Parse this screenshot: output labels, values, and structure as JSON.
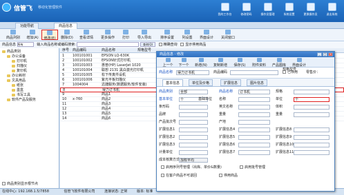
{
  "app": {
    "brand": "信管飞",
    "slogan": "移动化管理软件"
  },
  "top_buttons": [
    "我的工作台",
    "修改密码",
    "操作员管理",
    "系统设置",
    "更换操作员",
    "退出系统"
  ],
  "tabs": [
    "功能导航",
    "商品信息"
  ],
  "toolbar": [
    "商品列别",
    "增加(A)",
    "修改(E)",
    "删除(D)",
    "查看详情",
    "更多操作",
    "打印",
    "导入导出",
    "排序设置",
    "列设置",
    "界面设计",
    "关闭窗口"
  ],
  "search": {
    "type_label": "商品信息",
    "type_value": "所有",
    "hint": "输入商品名称或编码搜索:",
    "search_btn": "查询(Q)",
    "check1": "精确查询",
    "check2": "显示停用商品"
  },
  "tree": {
    "root": "商品类别",
    "nodes": [
      "办公设备",
      "打印机",
      "扫描仪",
      "复印机",
      "办公耗材",
      "文具用品",
      "纸张",
      "墨盒",
      "书写工具",
      "软件产品及服务"
    ],
    "bottom_check": "商品类别显示根节点"
  },
  "grid": {
    "headers": [
      "序号",
      "商品编码",
      "商品名称",
      "规格型号"
    ],
    "rows": [
      [
        "1",
        "100101001",
        "EPSON LQ-630K",
        ""
      ],
      [
        "2",
        "100101002",
        "EPSON针式打印机",
        ""
      ],
      [
        "3",
        "100101003",
        "惠普(HP) LaserJet 1020",
        ""
      ],
      [
        "4",
        "100101004",
        "联想 2131 黑白激光打印机",
        ""
      ],
      [
        "5",
        "100101005",
        "松下传真件设机",
        ""
      ],
      [
        "6",
        "100101006",
        "紫光平板扫描仪",
        ""
      ],
      [
        "7",
        "1004004",
        "迅捷服务(数据服务/软件安装)",
        ""
      ],
      [
        "8",
        "",
        "得力订书机",
        ""
      ],
      [
        "9",
        "",
        "商品1",
        ""
      ],
      [
        "10",
        "x-760",
        "商品2",
        ""
      ],
      [
        "11",
        "",
        "商品3",
        ""
      ],
      [
        "12",
        "",
        "商品4",
        ""
      ],
      [
        "13",
        "",
        "商品5",
        ""
      ],
      [
        "14",
        "",
        "商品6",
        ""
      ]
    ]
  },
  "status": {
    "server": "在线中心: 192.168.1.5/7858",
    "company": "信管飞软件有限公司",
    "state": "连接状态: 正常",
    "version": "版本: 标准"
  },
  "dialog": {
    "title": "商品信息 - 修改",
    "toolbar": [
      "上一个",
      "下一个",
      "新增(N)",
      "复制新增",
      "保存(S)",
      "附件资料",
      "产品图库",
      "界面设计"
    ],
    "name_label": "商品名称",
    "name_value": "得力订书机",
    "code_label": "商品编码",
    "code_value": "",
    "stop_label": "已停用",
    "price_label": "零售价：",
    "spec_label": "规格型号",
    "tabs": [
      "基本信息",
      "单位及价格",
      "扩展信息",
      "图片信息"
    ],
    "fields_left": [
      "商品类别",
      "基本单位",
      "条形码",
      "品牌",
      "产品批次号",
      "扩展信息1",
      "扩展信息2",
      "扩展信息3",
      "计量单位",
      "成本核算方式"
    ],
    "values_left": [
      "全部",
      "个",
      "",
      "",
      "",
      "",
      "",
      "",
      "",
      "加权平均"
    ],
    "fields_mid": [
      "商品名称",
      "名称",
      "英文名称",
      "重量",
      "产地",
      "扩展信息4",
      "扩展信息5",
      "扩展信息6",
      "扩展信息7"
    ],
    "values_mid": [
      "订书机",
      "",
      "",
      "",
      "",
      "",
      "",
      "",
      "",
      ""
    ],
    "fields_right": [
      "规格",
      "单位",
      "体积",
      "重量",
      "",
      "扩展信息8",
      "扩展信息9",
      "扩展信息10",
      "扩展信息11"
    ],
    "values_right": [
      "",
      "个",
      "",
      "",
      "",
      "",
      "",
      "",
      ""
    ],
    "base_unit_type": "基础单位",
    "check1": "启用序列号管理（出库、单价&数量)",
    "check2": "启用批号管理",
    "check3": "在客户商品不可退回",
    "check4": "停用商品"
  }
}
